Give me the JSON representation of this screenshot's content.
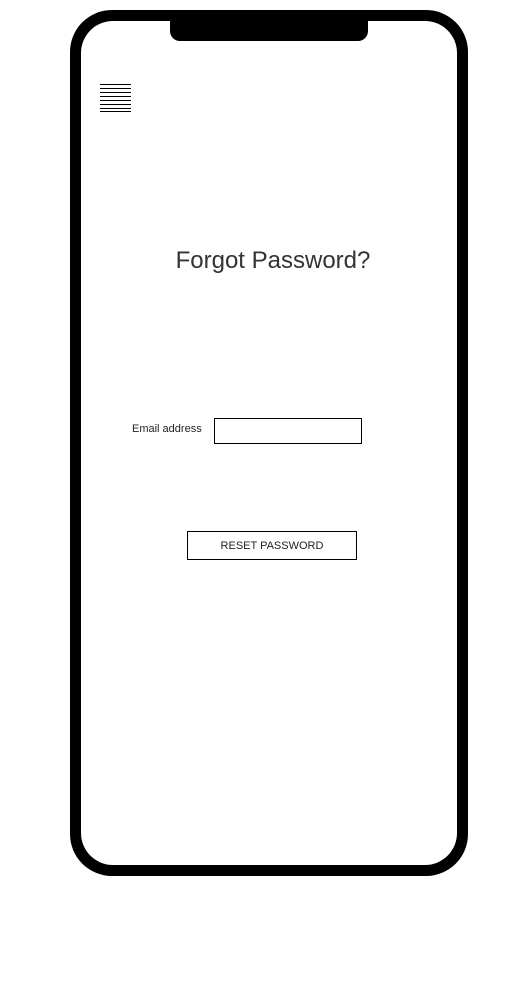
{
  "page": {
    "title": "Forgot Password?"
  },
  "menu": {
    "icon": "hamburger-menu-icon"
  },
  "form": {
    "email_label": "Email address",
    "email_value": "",
    "email_placeholder": "",
    "reset_label": "RESET PASSWORD"
  },
  "colors": {
    "frame": "#000000",
    "screen": "#ffffff",
    "text": "#333333"
  }
}
